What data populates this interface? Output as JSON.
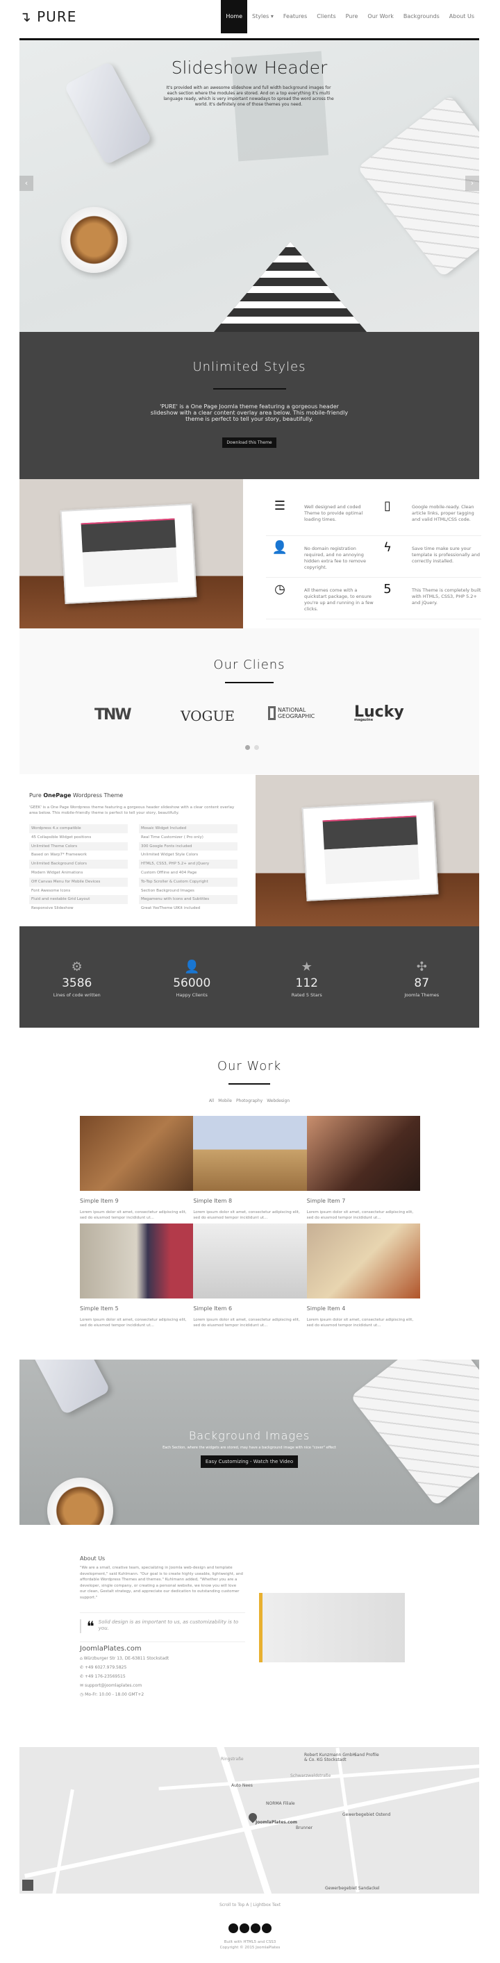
{
  "nav": {
    "logo": "PURE",
    "items": [
      {
        "label": "Home",
        "active": true
      },
      {
        "label": "Styles ▾"
      },
      {
        "label": "Features"
      },
      {
        "label": "Clients"
      },
      {
        "label": "Pure"
      },
      {
        "label": "Our Work"
      },
      {
        "label": "Backgrounds"
      },
      {
        "label": "About Us"
      }
    ]
  },
  "hero": {
    "title": "Slideshow Header",
    "text": "It's provided with an awesome slideshow and full width background images for each section where the modules are stored. And on a top everything it's multi language ready, which is very important nowadays to spread the word across the world. It's definitely one of those themes you need.",
    "prev": "‹",
    "next": "›"
  },
  "styles": {
    "title": "Unlimited Styles",
    "text": "'PURE' is a One Page Joomla theme featuring a gorgeous header slideshow with a clear content overlay area below. This mobile-friendly theme is perfect to tell your story, beautifully.",
    "button": "Download this Theme"
  },
  "features": [
    {
      "icon": "sliders-icon",
      "glyph": "☰",
      "text": "Well designed and coded Theme to provide optimal loading times."
    },
    {
      "icon": "mobile-icon",
      "glyph": "▯",
      "text": "Google mobile-ready. Clean article links, proper tagging and valid HTML/CSS code."
    },
    {
      "icon": "user-icon",
      "glyph": "👤",
      "text": "No domain registration required, and no annoying hidden extra fee to remove copyright."
    },
    {
      "icon": "bolt-icon",
      "glyph": "ϟ",
      "text": "Save time make sure your template is professionally and correctly installed."
    },
    {
      "icon": "clock-icon",
      "glyph": "◷",
      "text": "All themes come with a quickstart package, to ensure you're up and running in a few clicks."
    },
    {
      "icon": "html5-icon",
      "glyph": "5",
      "text": "This Theme is completely built with HTML5, CSS3, PHP 5.2+ and jQuery."
    }
  ],
  "clients": {
    "title": "Our Cliens",
    "logos": [
      "TNW",
      "VOGUE",
      "NATIONAL GEOGRAPHIC",
      "Lucky"
    ],
    "logo_sub": "magazine",
    "active_dot": 0,
    "dot_count": 2
  },
  "pure": {
    "title_pre": "Pure ",
    "title_bold": "OnePage",
    "title_post": " Wordpress Theme",
    "text": "'GEEK' is a One Page Wordpress theme featuring a gorgeous header slideshow with a clear content overlay area below. This mobile-friendly theme is perfect to tell your story, beautifully.",
    "list": [
      "Wordpress 4.x compatible",
      "Mosaic Widget Included",
      "45 Collapsible Widget positions",
      "Real Time Customizer ( Pro only)",
      "Unlimited Theme Colors",
      "300 Google Fonts included",
      "Based on Warp7* Framework",
      "Unlimited Widget Style Colors",
      "Unlimited Background Colors",
      "HTML5, CSS3, PHP 5.2+ and jQuery",
      "Modern Widget Animations",
      "Custom Offline and 404 Page",
      "Off Canvas Menu for Mobile Devices",
      "To-Top Scroller & Custom Copyright",
      "Font Awesome Icons",
      "Section Background Images",
      "Fluid and nestable Grid Layout",
      "Megamenu with Icons and Subtitles",
      "Responsive Slideshow",
      "Great YooTheme UIKit included"
    ]
  },
  "stats": [
    {
      "icon": "gear-icon",
      "glyph": "⚙",
      "value": "3586",
      "label": "Lines of code written"
    },
    {
      "icon": "user-icon",
      "glyph": "👤",
      "value": "56000",
      "label": "Happy Clients"
    },
    {
      "icon": "star-icon",
      "glyph": "★",
      "value": "112",
      "label": "Rated 5 Stars"
    },
    {
      "icon": "joomla-icon",
      "glyph": "✣",
      "value": "87",
      "label": "Joomla Themes"
    }
  ],
  "work": {
    "title": "Our Work",
    "filters": [
      "All",
      "Mobile",
      "Photography",
      "Webdesign"
    ],
    "items": [
      {
        "title": "Simple Item 9",
        "text": "Lorem ipsum dolor sit amet, consectetur adipiscing elit, sed do eiusmod tempor incididunt ut..."
      },
      {
        "title": "Simple Item 8",
        "text": "Lorem ipsum dolor sit amet, consectetur adipiscing elit, sed do eiusmod tempor incididunt ut..."
      },
      {
        "title": "Simple Item 7",
        "text": "Lorem ipsum dolor sit amet, consectetur adipiscing elit, sed do eiusmod tempor incididunt ut..."
      },
      {
        "title": "Simple Item 5",
        "text": "Lorem ipsum dolor sit amet, consectetur adipiscing elit, sed do eiusmod tempor incididunt ut..."
      },
      {
        "title": "Simple Item 6",
        "text": "Lorem ipsum dolor sit amet, consectetur adipiscing elit, sed do eiusmod tempor incididunt ut..."
      },
      {
        "title": "Simple Item 4",
        "text": "Lorem ipsum dolor sit amet, consectetur adipiscing elit, sed do eiusmod tempor incididunt ut..."
      }
    ]
  },
  "backgrounds": {
    "title": "Background Images",
    "text": "Each Section, where the widgets are stored, may have a background image with nice \"cover\" effect",
    "button": "Easy Customizing - Watch the Video"
  },
  "about": {
    "title": "About Us",
    "text": "\"We are a small, creative team, specializing in Joomla web-design and template development,\" said Kuhlmann. \"Our goal is to create highly useable, lightweight, and affordable Wordpress Themes and themes.\" Kuhlmann added, \"Whether you are a developer, single company, or creating a personal website, we know you will love our clean, Gestalt strategy, and appreciate our dedication to outstanding customer support.\"",
    "quote": "Solid design is as important to us, as customizability is to you.",
    "company": "JoomlaPlates.com",
    "address": "Würzburger Str 13, DE-63811 Stockstadt",
    "phone1": "+49 6027.979.5825",
    "phone2": "+49 176-23569515",
    "email": "support@joomlaplates.com",
    "hours": "Mo-Fr: 10.00 - 18.00 GMT+2"
  },
  "map": {
    "labels": [
      "Robert Kunzmann GmbH & Co. KG Stockstadt",
      "Sand Profile",
      "Auto Nees",
      "NORMA Filiale",
      "Gewerbegebiet Ostend",
      "JoomlaPlates.com",
      "Brunner",
      "Gewerbegebiet Sandackel",
      "Ringstraße",
      "Schwarzwaldstraße"
    ]
  },
  "footer": {
    "scroll": "Scroll to Top A | Lightbox Text",
    "built": "Built with HTML5 and CSS3",
    "copyright": "Copyright © 2015 JoomlaPlates"
  }
}
